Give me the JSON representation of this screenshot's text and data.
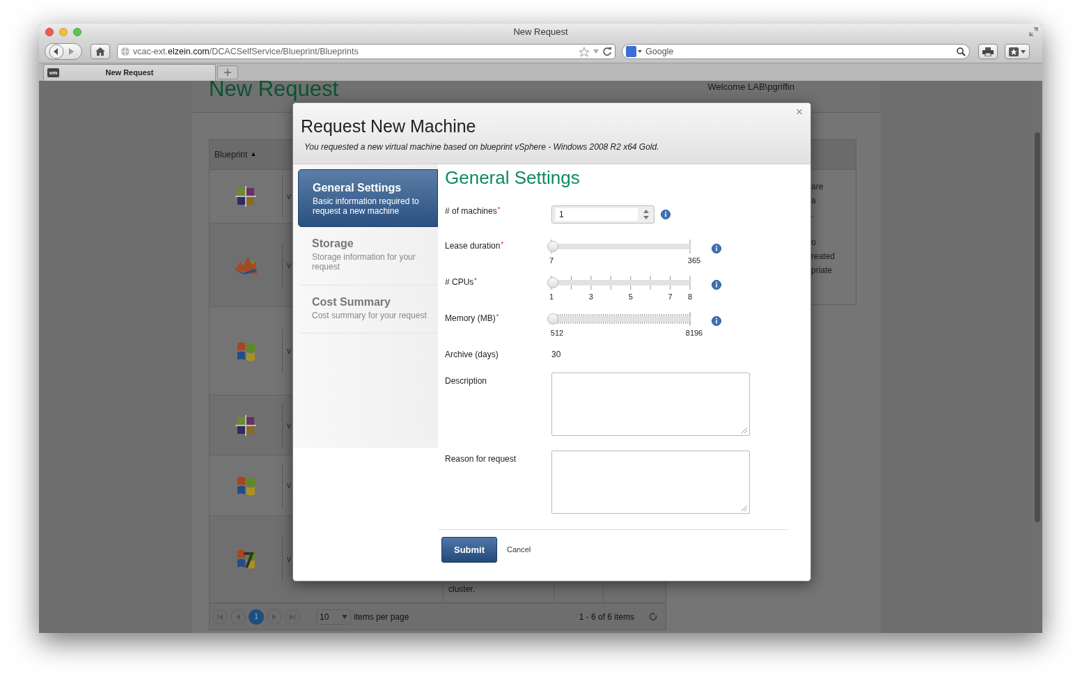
{
  "browser": {
    "title": "New Request",
    "url_prefix": "vcac-ext.",
    "url_domain": "elzein.com",
    "url_path": "/DCACSelfService/Blueprint/Blueprints",
    "search_placeholder": "Google",
    "tabs": [
      {
        "badge": "vm",
        "label": "New Request",
        "selected": true
      }
    ]
  },
  "page": {
    "title": "New Request",
    "welcome": "Welcome LAB\\pgriffin",
    "table": {
      "sort_column": "Blueprint",
      "sort_mark": "▲",
      "rows": [
        {
          "kind": "cross",
          "name": "v"
        },
        {
          "kind": "mountain",
          "name": "v"
        },
        {
          "kind": "flag",
          "name": "v"
        },
        {
          "kind": "cross",
          "name": "v"
        },
        {
          "kind": "flag",
          "name": "v"
        },
        {
          "kind": "flag7",
          "name": "v",
          "note": "cluster."
        }
      ],
      "side_text": [
        [
          "are",
          "a",
          "."
        ],
        [
          "o",
          "reated",
          "priate"
        ]
      ]
    },
    "pager": {
      "pages": [
        {
          "label": "1",
          "selected": true
        }
      ],
      "page_size": "10",
      "page_size_label": "items per page",
      "summary": "1 - 6 of 6 items"
    }
  },
  "modal": {
    "title": "Request New Machine",
    "subtitle": "You requested a new virtual machine based on blueprint vSphere - Windows 2008 R2 x64 Gold.",
    "close": "×",
    "steps": [
      {
        "title": "General Settings",
        "description": "Basic information required to request a new machine",
        "selected": true
      },
      {
        "title": "Storage",
        "description": "Storage information for your request",
        "selected": false
      },
      {
        "title": "Cost Summary",
        "description": "Cost summary for your request",
        "selected": false
      }
    ],
    "heading": "General Settings",
    "fields": [
      {
        "kind": "spinner",
        "label": "# of machines",
        "required_mark": "*",
        "value": "1",
        "info": true
      },
      {
        "kind": "range_slider",
        "label": "Lease duration",
        "required_mark": "*",
        "level": 0,
        "tick_labels": [
          "7",
          "365"
        ],
        "info": true
      },
      {
        "kind": "step_slider",
        "label": "# CPUs",
        "required_mark": "*",
        "level": 0,
        "tick_labels": [
          "1",
          "3",
          "5",
          "7",
          "8"
        ],
        "info": true
      },
      {
        "kind": "fine_slider",
        "label": "Memory (MB)",
        "required_mark": "*",
        "level": 0,
        "tick_labels": [
          "512",
          "8196"
        ],
        "info": true
      },
      {
        "kind": "text",
        "label": "Archive (days)",
        "value": "30",
        "info": false
      },
      {
        "kind": "textarea",
        "label": "Description",
        "info": false
      },
      {
        "kind": "textarea",
        "label": "Reason for request",
        "info": false
      }
    ],
    "buttons": [
      {
        "kind": "primary",
        "label": "Submit"
      },
      {
        "kind": "link",
        "label": "Cancel"
      }
    ]
  }
}
